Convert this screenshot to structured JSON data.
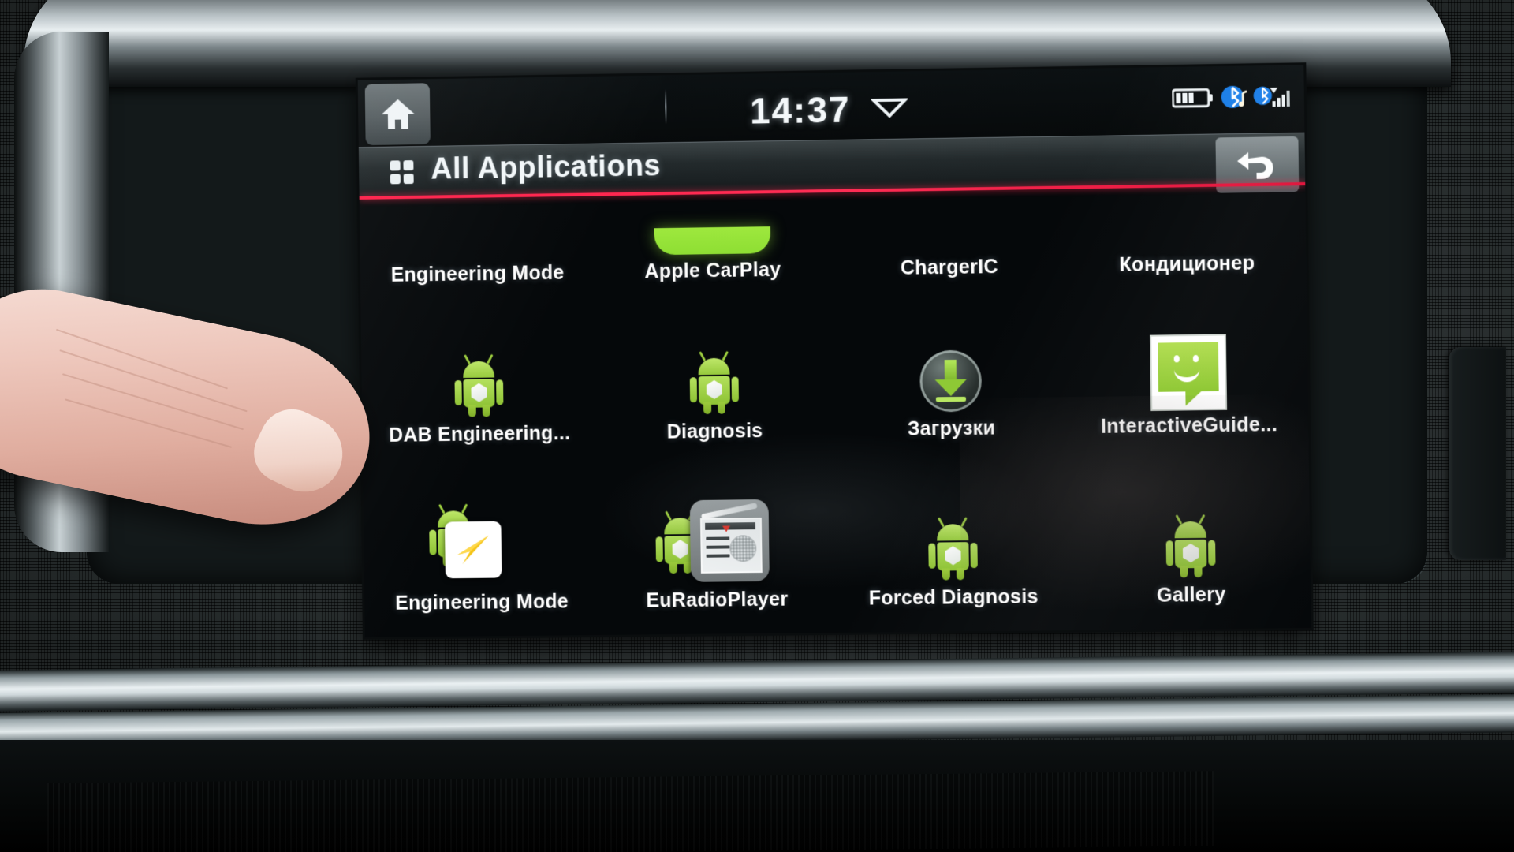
{
  "device": {
    "kind": "car-infotainment-head-unit",
    "screen_label": "touchscreen"
  },
  "statusbar": {
    "home_icon": "home-icon",
    "time": "14:37",
    "caret_icon": "chevron-down-icon",
    "icons": [
      {
        "name": "battery-icon",
        "label": "battery"
      },
      {
        "name": "bluetooth-audio-icon",
        "label": "bluetooth-audio"
      },
      {
        "name": "bluetooth-signal-icon",
        "label": "bluetooth-signal"
      }
    ]
  },
  "titlebar": {
    "grid_icon": "apps-grid-icon",
    "title": "All Applications",
    "back_icon": "back-arrow-icon",
    "accent_color": "#ff2550"
  },
  "apps": {
    "rows": [
      [
        {
          "label": "Engineering Mode",
          "icon": "android-robot-icon"
        },
        {
          "label": "Apple CarPlay",
          "icon": "carplay-icon"
        },
        {
          "label": "ChargerIC",
          "icon": "android-robot-icon"
        },
        {
          "label": "Кондиционер",
          "icon": "android-robot-icon"
        }
      ],
      [
        {
          "label": "DAB Engineering...",
          "icon": "android-robot-icon"
        },
        {
          "label": "Diagnosis",
          "icon": "android-robot-icon"
        },
        {
          "label": "Загрузки",
          "icon": "download-icon"
        },
        {
          "label": "InteractiveGuide...",
          "icon": "message-bubble-icon"
        }
      ],
      [
        {
          "label": "Engineering Mode",
          "icon": "navigation-arrow-icon"
        },
        {
          "label": "EuRadioPlayer",
          "icon": "radio-icon"
        },
        {
          "label": "Forced Diagnosis",
          "icon": "android-robot-icon"
        },
        {
          "label": "Gallery",
          "icon": "android-robot-icon"
        }
      ]
    ]
  },
  "colors": {
    "screen_bg": "#05080a",
    "accent_red": "#ff2550",
    "android_green": "#9ccd3f",
    "label_white": "#ffffff",
    "bluetooth_blue": "#1a7ee8"
  }
}
